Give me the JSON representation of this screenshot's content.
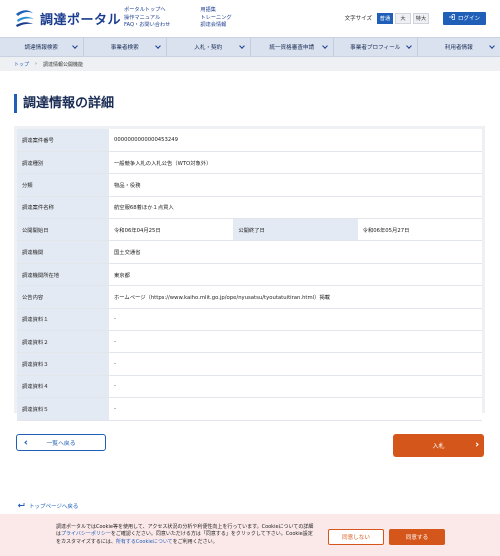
{
  "header": {
    "logo_text": "調達ポータル",
    "links_col1": [
      "ポータルトップへ",
      "操作マニュアル",
      "FAQ・お問い合わせ"
    ],
    "links_col2": [
      "用語集",
      "トレーニング",
      "調達会情報"
    ],
    "font_size_label": "文字サイズ",
    "font_sizes": [
      "普通",
      "大",
      "特大"
    ],
    "login_label": "ログイン"
  },
  "nav": [
    "調達情報検索",
    "事業者検索",
    "入札・契約",
    "統一資格審査申請",
    "事業者プロフィール",
    "利用者情報"
  ],
  "breadcrumb": {
    "home": "トップ",
    "current": "調達情報公開機能"
  },
  "page_title": "調達情報の詳細",
  "details": {
    "case_no_label": "調達案件番号",
    "case_no": "0000000000000453249",
    "type_label": "調達種別",
    "type": "一般競争入札の入札公告（WTO対象外）",
    "category_label": "分類",
    "category": "物品・役務",
    "name_label": "調達案件名称",
    "name": "航空服68着ほか１点買入",
    "pub_start_label": "公開開始日",
    "pub_start": "令和06年04月25日",
    "pub_end_label": "公開終了日",
    "pub_end": "令和06年05月27日",
    "agency_label": "調達機関",
    "agency": "国土交通省",
    "location_label": "調達機関所在地",
    "location": "東京都",
    "notice_label": "公告内容",
    "notice": "ホームページ（https://www.kaiho.mlit.go.jp/ope/nyusatsu/tyoutatuitiran.html）掲載",
    "doc1_label": "調達資料１",
    "doc1": "-",
    "doc2_label": "調達資料２",
    "doc2": "-",
    "doc3_label": "調達資料３",
    "doc3": "-",
    "doc4_label": "調達資料４",
    "doc4": "-",
    "doc5_label": "調達資料５",
    "doc5": "-"
  },
  "buttons": {
    "back": "一覧へ戻る",
    "bid": "入札"
  },
  "toplink": "トップページへ戻る",
  "cookie": {
    "text_1": "調達ポータルではCookie等を使用して、アクセス状況の分析や利便性向上を行っています。Cookieについての詳細は",
    "privacy_link": "プライバシーポリシー",
    "text_2": "をご確認ください。同意いただける方は「同意する」をクリックして下さい。Cookie設定をカスタマイズするには、",
    "settings_link": "所有するCookieについて",
    "text_3": "をご利用ください。",
    "deny": "同意しない",
    "accept": "同意する"
  },
  "colors": {
    "brand": "#1f5fb8",
    "accent": "#d5561a",
    "nav_bg": "#d9e2ee"
  }
}
